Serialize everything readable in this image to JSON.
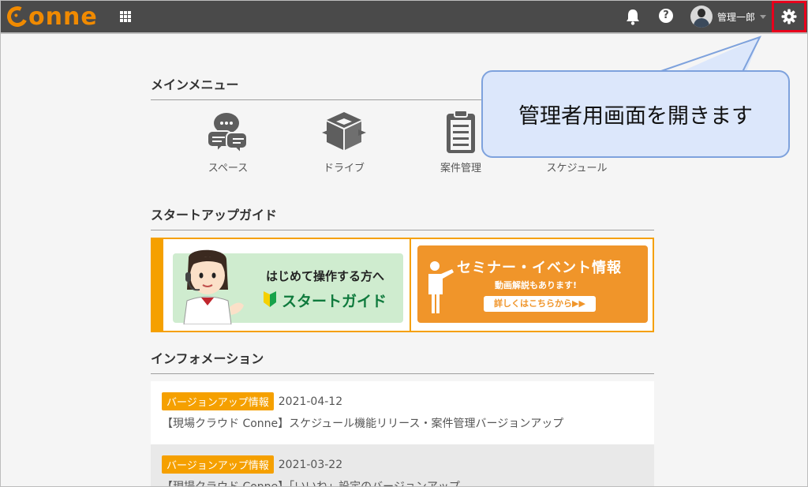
{
  "app": {
    "logo_text": "onne"
  },
  "header": {
    "user_name": "管理一郎",
    "icons": [
      "apps-grid-icon",
      "bell-icon",
      "help-icon",
      "gear-icon"
    ],
    "help_glyph": "?"
  },
  "main_menu": {
    "title": "メインメニュー",
    "items": [
      {
        "label": "スペース",
        "icon": "chat-bubbles-icon"
      },
      {
        "label": "ドライブ",
        "icon": "box-drive-icon"
      },
      {
        "label": "案件管理",
        "icon": "clipboard-icon"
      },
      {
        "label": "スケジュール",
        "icon": "calendar-icon"
      }
    ]
  },
  "startup": {
    "title": "スタートアップガイド",
    "left_banner": {
      "line1": "はじめて操作する方へ",
      "line2": "スタートガイド"
    },
    "right_banner": {
      "title": "セミナー・イベント情報",
      "subtitle": "動画解説もあります!",
      "button": "詳しくはこちらから▶▶"
    }
  },
  "information": {
    "title": "インフォメーション",
    "items": [
      {
        "tag": "バージョンアップ情報",
        "date": "2021-04-12",
        "text": "【現場クラウド Conne】スケジュール機能リリース・案件管理バージョンアップ"
      },
      {
        "tag": "バージョンアップ情報",
        "date": "2021-03-22",
        "text": "【現場クラウド Conne】「いいね」設定のバージョンアップ"
      }
    ]
  },
  "callout": {
    "text": "管理者用画面を開きます"
  },
  "colors": {
    "accent": "#f5a000",
    "topbar": "#4a4a4a",
    "highlight": "#e8001c",
    "callout_bg": "#dce7fb"
  }
}
